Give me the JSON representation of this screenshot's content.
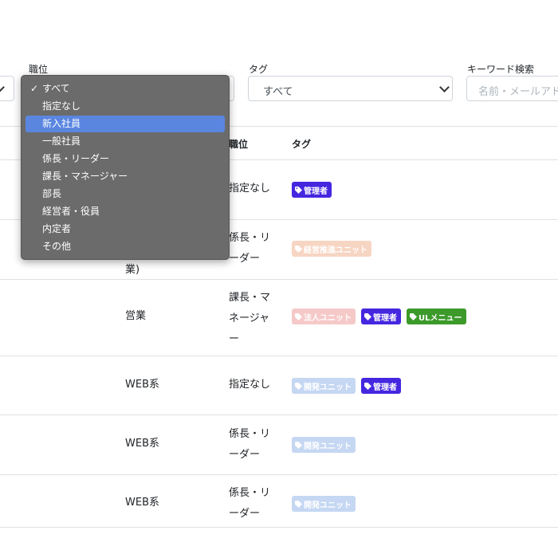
{
  "filters": {
    "position_label": "職位",
    "tag_label": "タグ",
    "tag_value": "すべて",
    "keyword_label": "キーワード検索",
    "keyword_placeholder": "名前・メールアド"
  },
  "position_dropdown": {
    "options": [
      "すべて",
      "指定なし",
      "新入社員",
      "一般社員",
      "係長・リーダー",
      "課長・マネージャー",
      "部長",
      "経営者・役員",
      "内定者",
      "その他"
    ],
    "checked": "すべて",
    "highlighted": "新入社員"
  },
  "table": {
    "headers": {
      "position": "職位",
      "tags": "タグ"
    },
    "rows": [
      {
        "department": "",
        "position": "指定なし",
        "tags": [
          "管理者"
        ]
      },
      {
        "department": "業)",
        "position": "係長・リーダー",
        "tags": [
          "経営推進ユニット"
        ]
      },
      {
        "department": "営業",
        "position": "課長・マネージャー",
        "tags": [
          "法人ユニット",
          "管理者",
          "ULメニュー"
        ]
      },
      {
        "department": "WEB系",
        "position": "指定なし",
        "tags": [
          "開発ユニット",
          "管理者"
        ]
      },
      {
        "department": "WEB系",
        "position": "係長・リーダー",
        "tags": [
          "開発ユニット"
        ]
      },
      {
        "department": "WEB系",
        "position": "係長・リーダー",
        "tags": [
          "開発ユニット"
        ]
      }
    ]
  },
  "colors": {
    "tag_admin": "#4527e0",
    "tag_keiei": "#f7d5c3",
    "tag_houjin": "#f6c9c9",
    "tag_ul": "#3c9a2a",
    "tag_kaihatsu": "#c5d7f2",
    "dropdown_bg": "#6b6b6b",
    "dropdown_highlight": "#5a86e0"
  },
  "icons": {
    "tag": "tag-icon",
    "chevron": "chevron-down-icon",
    "check": "check-icon"
  }
}
